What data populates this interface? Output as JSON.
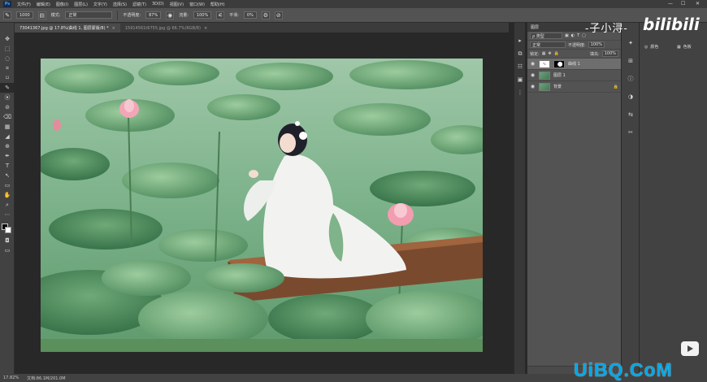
{
  "menubar": {
    "logo": "Ps",
    "items": [
      "文件(F)",
      "编辑(E)",
      "图像(I)",
      "图层(L)",
      "文字(Y)",
      "选择(S)",
      "滤镜(T)",
      "3D(D)",
      "视图(V)",
      "窗口(W)",
      "帮助(H)"
    ],
    "window_controls": [
      "—",
      "☐",
      "✕"
    ]
  },
  "options": {
    "brush_size": "1000",
    "mode_label": "模式:",
    "mode_value": "正常",
    "opacity_label": "不透明度:",
    "opacity_value": "87%",
    "flow_label": "流量:",
    "flow_value": "100%",
    "smooth_label": "平滑:",
    "smooth_value": "0%"
  },
  "tabs": [
    {
      "label": "73041367.jpg @ 17.8%(曲线 1, 图层蒙版/8) *",
      "close": "×"
    },
    {
      "label": "15914561t6755.jpg @ 66.7%(RGB/8)",
      "close": "×"
    }
  ],
  "toolbar": {
    "tools": [
      "✥",
      "⬚",
      "◌",
      "⌗",
      "⌑",
      "✎",
      "⦿",
      "⊘",
      "⌫",
      "▦",
      "◢",
      "⊕",
      "✒",
      "T",
      "↖",
      "▭",
      "✋",
      "⌕",
      "⋯"
    ]
  },
  "statusbar": {
    "zoom": "17.82%",
    "doc": "文档:86.1M/201.0M"
  },
  "mini_col": {
    "icons": [
      "▸",
      "⧉",
      "☷",
      "▣",
      "⋮"
    ]
  },
  "layers": {
    "tab": "图层",
    "filter_label": "ρ 类型",
    "blend_mode": "正常",
    "opacity_label": "不透明度:",
    "opacity_value": "100%",
    "lock_label": "锁定:",
    "fill_label": "填充:",
    "fill_value": "100%",
    "items": [
      {
        "name": "曲线 1",
        "thumb": "adj"
      },
      {
        "name": "图层 1",
        "thumb": "img"
      },
      {
        "name": "背景",
        "thumb": "img",
        "locked": true
      }
    ]
  },
  "tool_col": {
    "icons": [
      "✦",
      "⊞",
      "ⓘ",
      "◑",
      "⇆",
      "✂"
    ]
  },
  "props": {
    "items": [
      {
        "icon": "◎",
        "label": "颜色"
      },
      {
        "icon": "▦",
        "label": "色板"
      }
    ]
  },
  "watermarks": {
    "author": "-子小浔-",
    "site": "bilibili",
    "uibq": "UiBQ.CoM"
  }
}
